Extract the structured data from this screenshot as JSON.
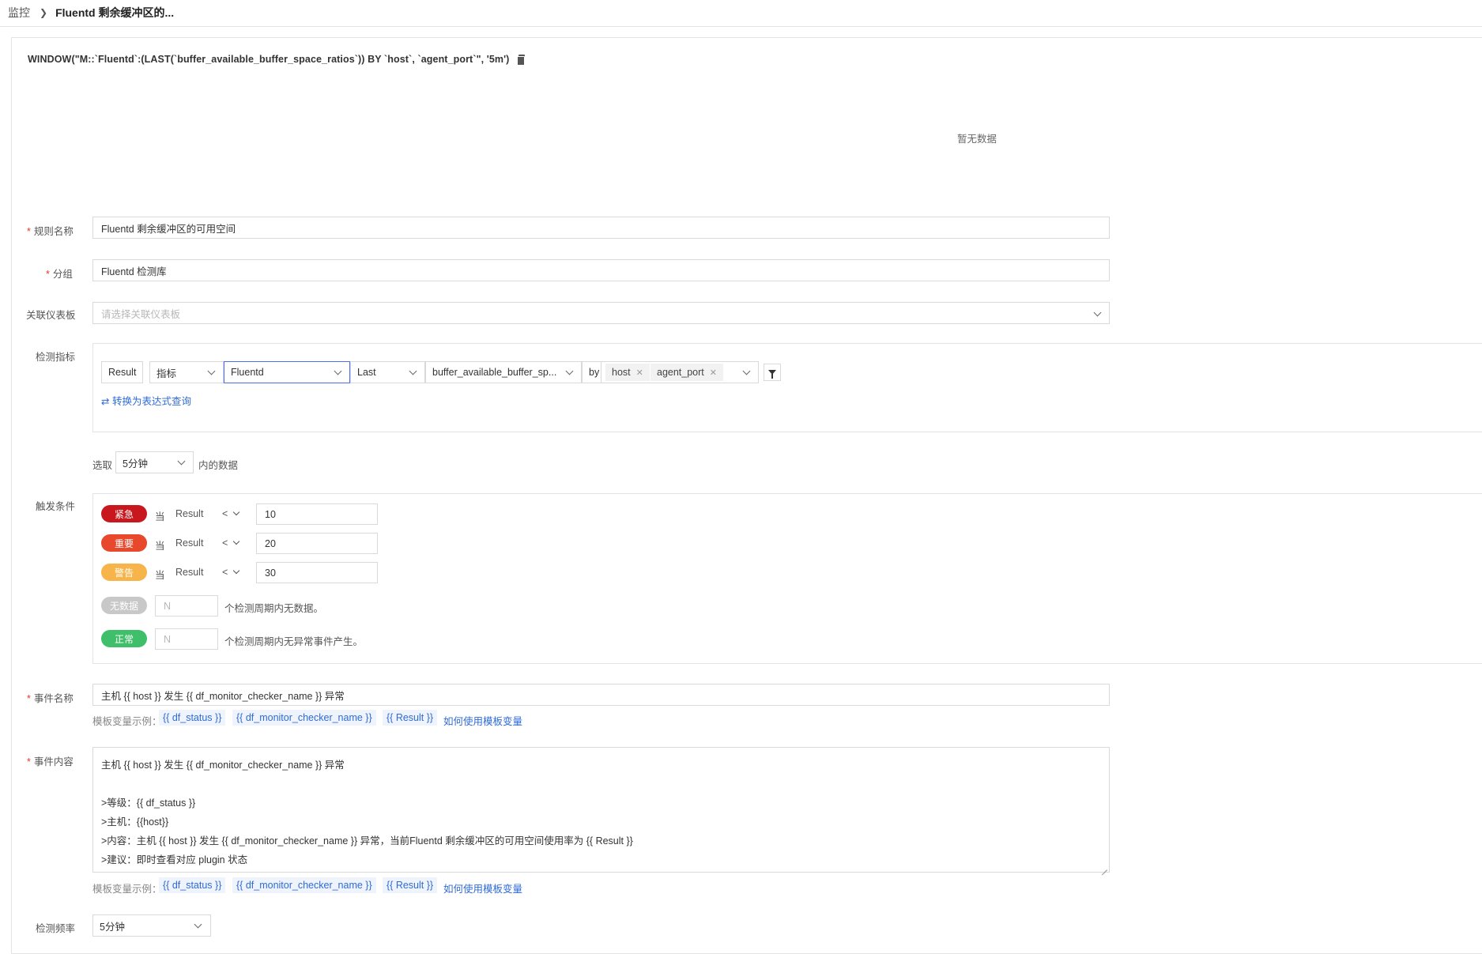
{
  "breadcrumb": {
    "root": "监控",
    "current": "Fluentd 剩余缓冲区的..."
  },
  "query": {
    "text": "WINDOW(\"M::`Fluentd`:(LAST(`buffer_available_buffer_space_ratios`)) BY `host`, `agent_port`\", '5m')",
    "copy_icon": "copy-icon"
  },
  "chart": {
    "empty_text": "暂无数据"
  },
  "form": {
    "rule_name": {
      "label": "规则名称",
      "value": "Fluentd 剩余缓冲区的可用空间"
    },
    "group": {
      "label": "分组",
      "value": "Fluentd 检测库"
    },
    "dashboard": {
      "label": "关联仪表板",
      "placeholder": "请选择关联仪表板"
    },
    "metric": {
      "label": "检测指标",
      "result": "Result",
      "type": "指标",
      "measurement": "Fluentd",
      "func": "Last",
      "field": "buffer_available_buffer_sp...",
      "by": "by",
      "tags": [
        "host",
        "agent_port"
      ],
      "convert_link": "⇄ 转换为表达式查询"
    },
    "range": {
      "prefix": "选取",
      "value": "5分钟",
      "suffix": "内的数据"
    },
    "trigger": {
      "label": "触发条件",
      "rows": [
        {
          "badge": "紧急",
          "color": "#c9171e",
          "when": "当",
          "field": "Result",
          "op": "<",
          "value": "10"
        },
        {
          "badge": "重要",
          "color": "#e8492d",
          "when": "当",
          "field": "Result",
          "op": "<",
          "value": "20"
        },
        {
          "badge": "警告",
          "color": "#f7b44a",
          "when": "当",
          "field": "Result",
          "op": "<",
          "value": "30"
        }
      ],
      "nodata": {
        "badge": "无数据",
        "color": "#c8c8c8",
        "placeholder": "N",
        "text": "个检测周期内无数据。"
      },
      "normal": {
        "badge": "正常",
        "color": "#3fbf6a",
        "placeholder": "N",
        "text": "个检测周期内无异常事件产生。"
      }
    },
    "event_name": {
      "label": "事件名称",
      "value": "主机 {{ host }} 发生 {{ df_monitor_checker_name }} 异常"
    },
    "template_hint": {
      "prefix": "模板变量示例：",
      "vars": [
        "{{ df_status }}",
        "{{ df_monitor_checker_name }}",
        "{{ Result }}"
      ],
      "help": "如何使用模板变量"
    },
    "event_content": {
      "label": "事件内容",
      "lines": [
        "主机 {{ host }} 发生 {{ df_monitor_checker_name }} 异常",
        "",
        ">等级：{{ df_status }}",
        ">主机：{{host}}",
        ">内容：主机 {{ host }} 发生 {{ df_monitor_checker_name }} 异常，当前Fluentd 剩余缓冲区的可用空间使用率为 {{ Result }}",
        ">建议：即时查看对应 plugin 状态"
      ]
    },
    "frequency": {
      "label": "检测频率",
      "value": "5分钟"
    }
  }
}
